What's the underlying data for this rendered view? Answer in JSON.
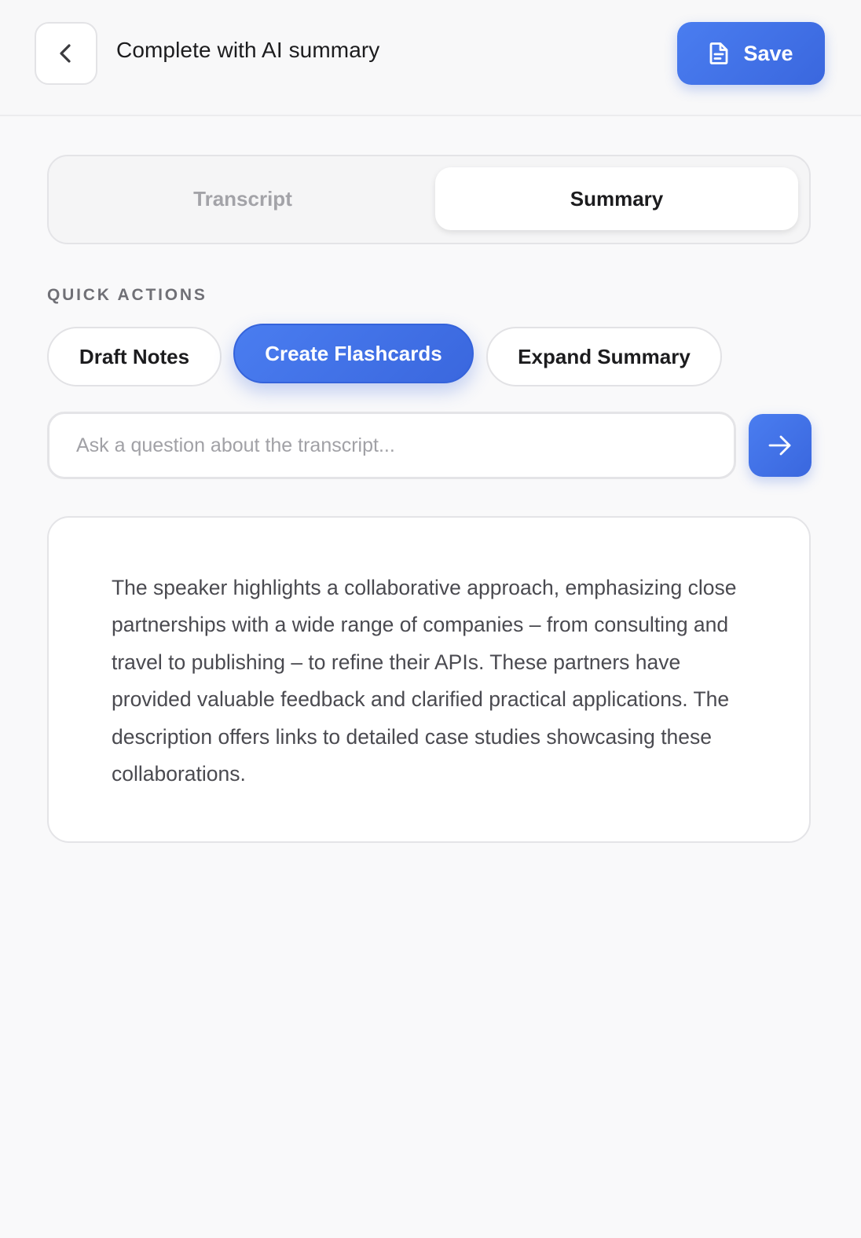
{
  "header": {
    "title": "Complete with AI summary",
    "save_label": "Save"
  },
  "tabs": [
    {
      "label": "Transcript",
      "active": false
    },
    {
      "label": "Summary",
      "active": true
    }
  ],
  "quick_actions": {
    "section_label": "QUICK ACTIONS",
    "items": [
      {
        "label": "Draft Notes",
        "selected": false
      },
      {
        "label": "Create Flashcards",
        "selected": true
      },
      {
        "label": "Expand Summary",
        "selected": false
      }
    ]
  },
  "ask": {
    "value": "",
    "placeholder": "Ask a question about the transcript..."
  },
  "summary": {
    "text": "The speaker highlights a collaborative approach, emphasizing close partnerships with a wide range of companies – from consulting and travel to publishing – to refine their APIs. These partners have provided valuable feedback and clarified practical applications. The description offers links to detailed case studies showcasing these collaborations."
  },
  "icons": {
    "back": "chevron-left-icon",
    "save": "document-icon",
    "send": "arrow-right-icon"
  },
  "colors": {
    "accent": "#4172e8",
    "background": "#f9f9fa",
    "text": "#1c1c1e",
    "muted_text": "#a3a3a8"
  }
}
